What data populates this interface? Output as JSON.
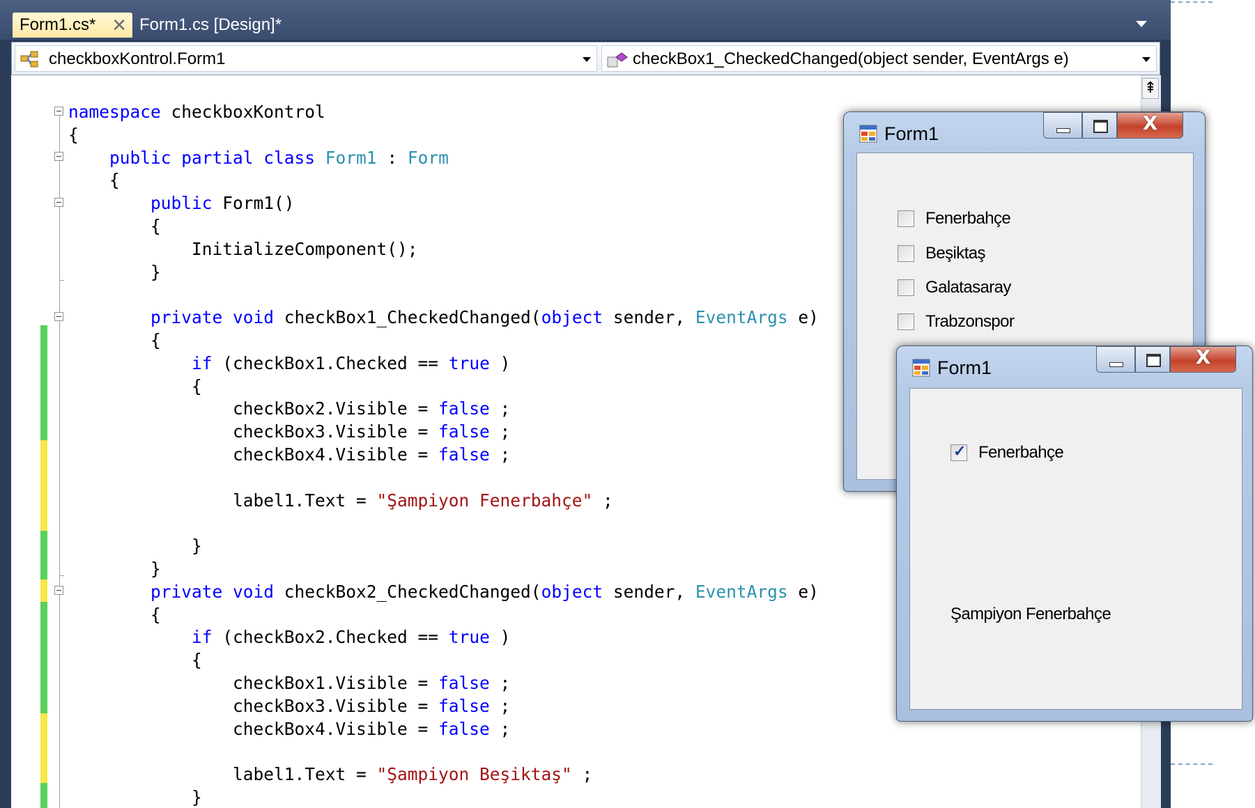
{
  "ide": {
    "tabs": [
      {
        "label": "Form1.cs*",
        "close": "✕"
      },
      {
        "label": "Form1.cs [Design]*"
      }
    ],
    "nav": {
      "type_combo": "checkboxKontrol.Form1",
      "member_combo": "checkBox1_CheckedChanged(object sender, EventArgs e)"
    },
    "split_button": "⇞",
    "code_lines": [
      [
        [
          "kw",
          "namespace"
        ],
        [
          "",
          "checkboxKontrol"
        ]
      ],
      [
        [
          "",
          "{"
        ]
      ],
      [
        [
          "",
          "    "
        ],
        [
          "kw",
          "public partial class"
        ],
        [
          "",
          ""
        ],
        [
          "ty",
          "Form1"
        ],
        [
          "",
          ": "
        ],
        [
          "ty",
          "Form"
        ]
      ],
      [
        [
          "",
          "    {"
        ]
      ],
      [
        [
          "",
          "        "
        ],
        [
          "kw",
          "public"
        ],
        [
          "",
          "Form1()"
        ]
      ],
      [
        [
          "",
          "        {"
        ]
      ],
      [
        [
          "",
          "            InitializeComponent();"
        ]
      ],
      [
        [
          "",
          "        }"
        ]
      ],
      [
        [
          "",
          ""
        ]
      ],
      [
        [
          "",
          "        "
        ],
        [
          "kw",
          "private void"
        ],
        [
          "",
          "checkBox1_CheckedChanged("
        ],
        [
          "kw",
          "object"
        ],
        [
          "",
          "sender, "
        ],
        [
          "ty",
          "EventArgs"
        ],
        [
          "",
          "e)"
        ]
      ],
      [
        [
          "",
          "        {"
        ]
      ],
      [
        [
          "",
          "            "
        ],
        [
          "kw",
          "if"
        ],
        [
          "",
          "(checkBox1.Checked == "
        ],
        [
          "kw",
          "true"
        ],
        [
          "",
          ")"
        ]
      ],
      [
        [
          "",
          "            {"
        ]
      ],
      [
        [
          "",
          "                checkBox2.Visible = "
        ],
        [
          "kw",
          "false"
        ],
        [
          "",
          ";"
        ]
      ],
      [
        [
          "",
          "                checkBox3.Visible = "
        ],
        [
          "kw",
          "false"
        ],
        [
          "",
          ";"
        ]
      ],
      [
        [
          "",
          "                checkBox4.Visible = "
        ],
        [
          "kw",
          "false"
        ],
        [
          "",
          ";"
        ]
      ],
      [
        [
          "",
          ""
        ]
      ],
      [
        [
          "",
          "                label1.Text = "
        ],
        [
          "st",
          "\"Şampiyon Fenerbahçe\""
        ],
        [
          "",
          ";"
        ]
      ],
      [
        [
          "",
          ""
        ]
      ],
      [
        [
          "",
          "            }"
        ]
      ],
      [
        [
          "",
          "        }"
        ]
      ],
      [
        [
          "",
          "        "
        ],
        [
          "kw",
          "private void"
        ],
        [
          "",
          "checkBox2_CheckedChanged("
        ],
        [
          "kw",
          "object"
        ],
        [
          "",
          "sender, "
        ],
        [
          "ty",
          "EventArgs"
        ],
        [
          "",
          "e)"
        ]
      ],
      [
        [
          "",
          "        {"
        ]
      ],
      [
        [
          "",
          "            "
        ],
        [
          "kw",
          "if"
        ],
        [
          "",
          "(checkBox2.Checked == "
        ],
        [
          "kw",
          "true"
        ],
        [
          "",
          ")"
        ]
      ],
      [
        [
          "",
          "            {"
        ]
      ],
      [
        [
          "",
          "                checkBox1.Visible = "
        ],
        [
          "kw",
          "false"
        ],
        [
          "",
          ";"
        ]
      ],
      [
        [
          "",
          "                checkBox3.Visible = "
        ],
        [
          "kw",
          "false"
        ],
        [
          "",
          ";"
        ]
      ],
      [
        [
          "",
          "                checkBox4.Visible = "
        ],
        [
          "kw",
          "false"
        ],
        [
          "",
          ";"
        ]
      ],
      [
        [
          "",
          ""
        ]
      ],
      [
        [
          "",
          "                label1.Text = "
        ],
        [
          "st",
          "\"Şampiyon Beşiktaş\""
        ],
        [
          "",
          ";"
        ]
      ],
      [
        [
          "",
          "            }"
        ]
      ]
    ],
    "colors": {
      "keyword": "#0000ff",
      "type": "#2b91af",
      "string": "#a31515",
      "change_saved": "#59d259",
      "change_unsaved": "#f7e847"
    }
  },
  "form_back": {
    "title": "Form1",
    "close_glyph": "X",
    "checkboxes": [
      {
        "label": "Fenerbahçe",
        "checked": false
      },
      {
        "label": "Beşiktaş",
        "checked": false
      },
      {
        "label": "Galatasaray",
        "checked": false
      },
      {
        "label": "Trabzonspor",
        "checked": false
      }
    ]
  },
  "form_front": {
    "title": "Form1",
    "close_glyph": "X",
    "checkbox": {
      "label": "Fenerbahçe",
      "checked": true,
      "tick": "✓"
    },
    "label1": "Şampiyon Fenerbahçe"
  },
  "icons": [
    "csharp-class-icon",
    "method-icon",
    "winform-app-icon"
  ]
}
